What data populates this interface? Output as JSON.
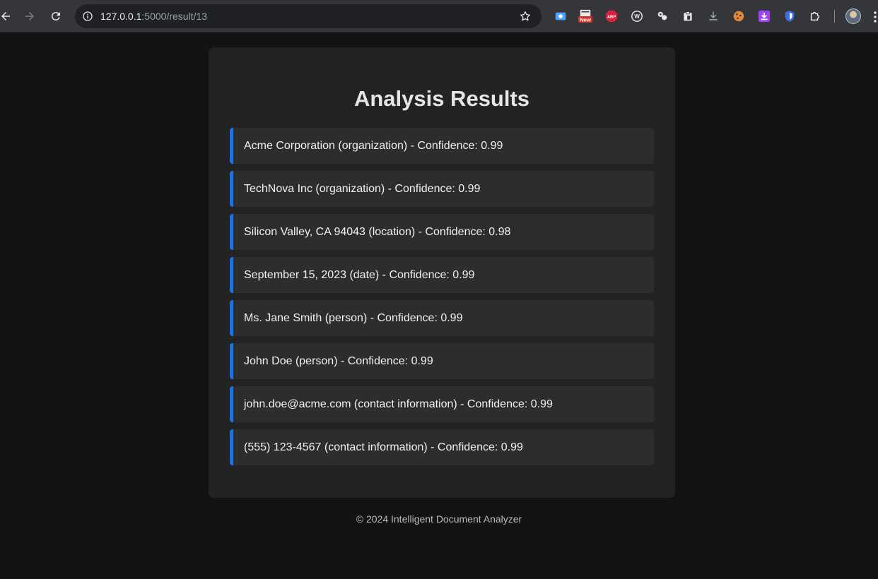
{
  "browser": {
    "url_host": "127.0.0.1",
    "url_path": ":5000/result/13",
    "extensions": [
      {
        "name": "screen-capture-icon",
        "color": "#4aa3ff"
      },
      {
        "name": "news-icon",
        "color": "#d93025",
        "badge": "New"
      },
      {
        "name": "adblock-icon",
        "color": "#d9213e",
        "label": "ABP"
      },
      {
        "name": "wordtune-icon",
        "color": "#e8eaed",
        "label": "W"
      },
      {
        "name": "link-icon",
        "color": "#e8eaed"
      },
      {
        "name": "clipboard-icon",
        "color": "#e8eaed"
      },
      {
        "name": "download-icon",
        "color": "#9aa0a6"
      },
      {
        "name": "cookie-icon",
        "color": "#e08a3c"
      },
      {
        "name": "purple-download-icon",
        "color": "#a142f4"
      },
      {
        "name": "shield-icon",
        "color": "#3b6fe0"
      },
      {
        "name": "puzzle-icon",
        "color": "#e8eaed"
      }
    ]
  },
  "page": {
    "title": "Analysis Results",
    "accent_color": "#1a73e8",
    "results": [
      "Acme Corporation (organization) - Confidence: 0.99",
      "TechNova Inc (organization) - Confidence: 0.99",
      "Silicon Valley, CA 94043 (location) - Confidence: 0.98",
      "September 15, 2023 (date) - Confidence: 0.99",
      "Ms. Jane Smith (person) - Confidence: 0.99",
      "John Doe (person) - Confidence: 0.99",
      "john.doe@acme.com (contact information) - Confidence: 0.99",
      "(555) 123-4567 (contact information) - Confidence: 0.99"
    ],
    "footer": "© 2024 Intelligent Document Analyzer"
  }
}
